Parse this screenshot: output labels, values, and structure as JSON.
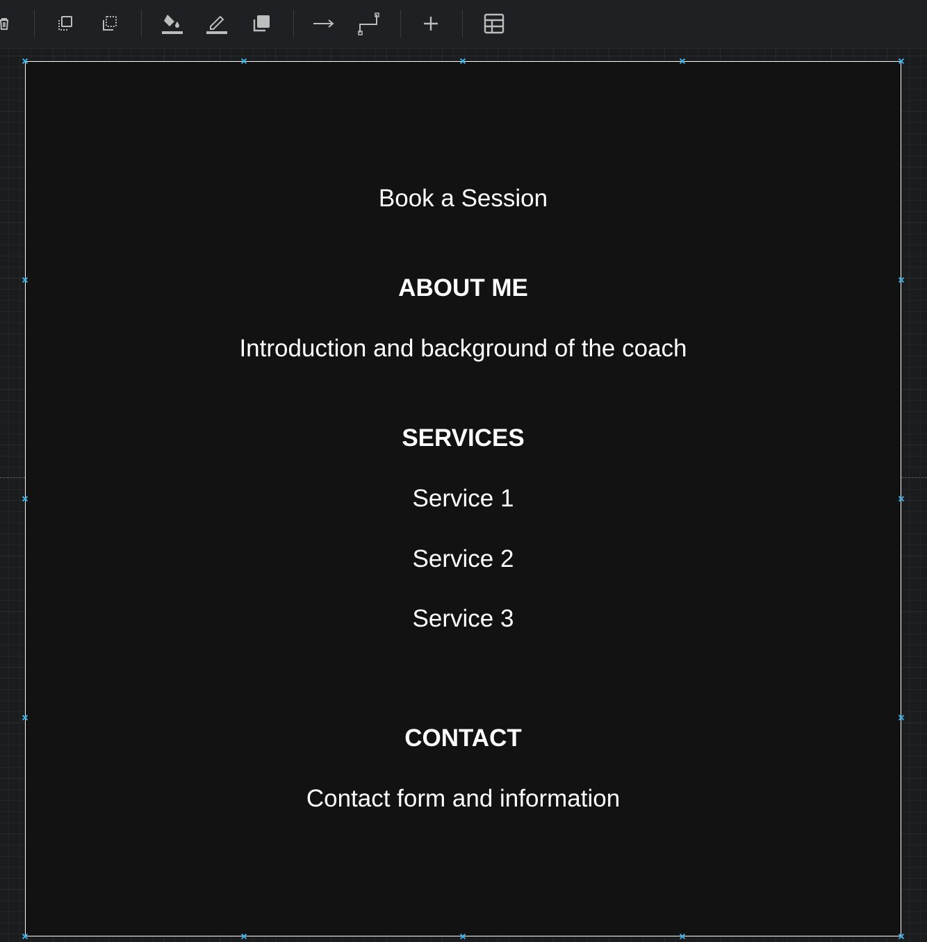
{
  "toolbar": {
    "items": [
      {
        "name": "delete-icon"
      },
      {
        "name": "to-front-icon"
      },
      {
        "name": "to-back-icon"
      },
      {
        "name": "fill-color-icon"
      },
      {
        "name": "line-color-icon"
      },
      {
        "name": "shadow-icon"
      },
      {
        "name": "connection-arrow-icon"
      },
      {
        "name": "waypoints-icon"
      },
      {
        "name": "insert-icon"
      },
      {
        "name": "table-icon"
      }
    ],
    "icon_color": "#bdbdbd"
  },
  "canvas": {
    "background": "#1b1c1e",
    "frame_background": "#121213",
    "frame_border": "#ffffff",
    "handle_color": "#3db3ee"
  },
  "page": {
    "book_label": "Book a Session",
    "about_heading": "ABOUT ME",
    "about_text": "Introduction and background of the coach",
    "services_heading": "SERVICES",
    "services": [
      "Service 1",
      "Service 2",
      "Service 3"
    ],
    "contact_heading": "CONTACT",
    "contact_text": "Contact form and information"
  }
}
